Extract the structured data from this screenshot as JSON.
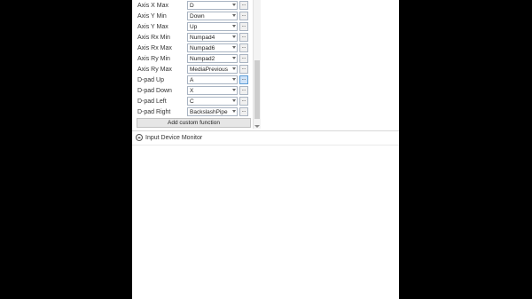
{
  "mappings": [
    {
      "label": "Axis X Max",
      "value": "D"
    },
    {
      "label": "Axis Y Min",
      "value": "Down"
    },
    {
      "label": "Axis Y Max",
      "value": "Up"
    },
    {
      "label": "Axis Rx Min",
      "value": "Numpad4"
    },
    {
      "label": "Axis Rx Max",
      "value": "Numpad6"
    },
    {
      "label": "Axis Ry Min",
      "value": "Numpad2"
    },
    {
      "label": "Axis Ry Max",
      "value": "MediaPrevious"
    },
    {
      "label": "D-pad Up",
      "value": "A"
    },
    {
      "label": "D-pad Down",
      "value": "X"
    },
    {
      "label": "D-pad Left",
      "value": "C"
    },
    {
      "label": "D-pad Right",
      "value": "BackslashPipe"
    }
  ],
  "dots_label": "...",
  "add_button_label": "Add custom function",
  "monitor_label": "Input Device Monitor",
  "icons": {
    "dropdown": "chevron-down-icon",
    "expand": "expand-up-icon"
  }
}
